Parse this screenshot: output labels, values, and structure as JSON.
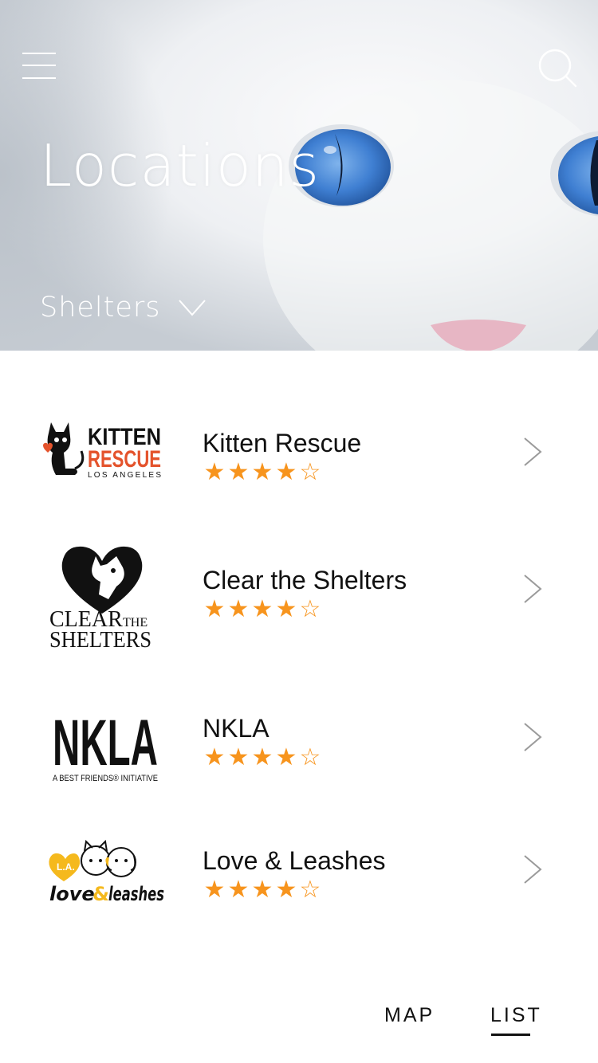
{
  "header": {
    "title": "Locations",
    "category_selector": {
      "selected": "Shelters"
    },
    "icons": {
      "menu": "hamburger-menu-icon",
      "search": "search-icon",
      "dropdown": "chevron-down-icon"
    }
  },
  "shelters": [
    {
      "name": "Kitten Rescue",
      "rating": 4,
      "max_rating": 5,
      "logo": {
        "line1": "KITTEN",
        "line2": "RESCUE",
        "line3": "LOS ANGELES"
      }
    },
    {
      "name": "Clear the Shelters",
      "rating": 4,
      "max_rating": 5,
      "logo": {
        "line1": "CLEAR",
        "line1b": "THE",
        "line2": "SHELTERS"
      }
    },
    {
      "name": "NKLA",
      "rating": 4,
      "max_rating": 5,
      "logo": {
        "line1": "NKLA",
        "line2": "A BEST FRIENDS® INITIATIVE"
      }
    },
    {
      "name": "Love & Leashes",
      "rating": 4,
      "max_rating": 5,
      "logo": {
        "badge": "L.A.",
        "line1": "love",
        "amp": "&",
        "line2": "leashes"
      }
    }
  ],
  "view_tabs": {
    "items": [
      {
        "label": "MAP",
        "active": false
      },
      {
        "label": "LIST",
        "active": true
      }
    ]
  },
  "colors": {
    "star": "#f7941d",
    "kitten_rescue_red": "#e4532c",
    "love_leashes_yellow": "#f5b91d",
    "text": "#111111",
    "hero_text": "#ffffff"
  }
}
